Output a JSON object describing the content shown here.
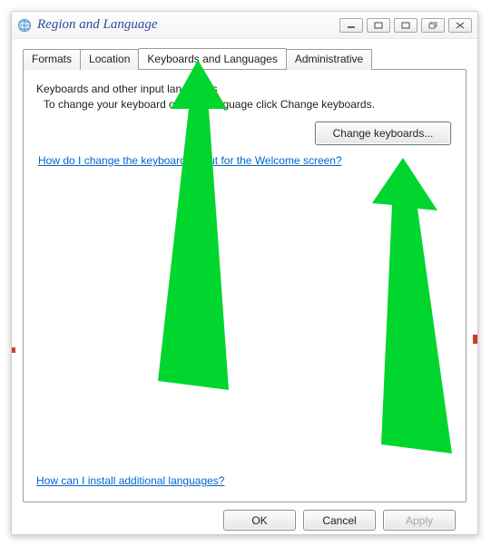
{
  "window": {
    "title": "Region and Language"
  },
  "tabs": {
    "formats": "Formats",
    "location": "Location",
    "keyboards": "Keyboards and Languages",
    "admin": "Administrative"
  },
  "panel": {
    "heading": "Keyboards and other input languages",
    "body": "To change your keyboard or input language click Change keyboards.",
    "change_btn": "Change keyboards...",
    "help_top": "How do I change the keyboard layout for the Welcome screen?",
    "help_bottom": "How can I install additional languages?"
  },
  "buttons": {
    "ok": "OK",
    "cancel": "Cancel",
    "apply": "Apply"
  }
}
